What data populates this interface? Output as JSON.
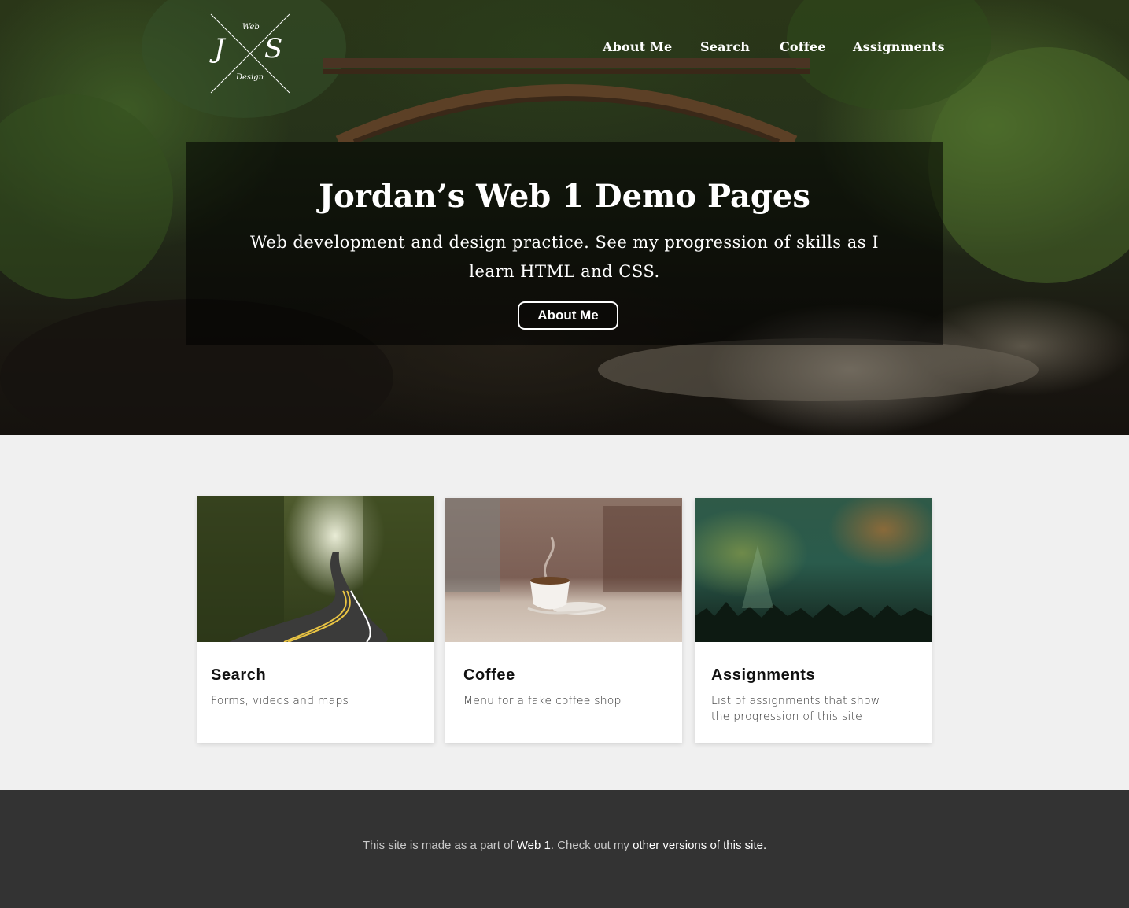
{
  "logo": {
    "initial_left": "J",
    "initial_right": "S",
    "top_word": "Web",
    "bottom_word": "Design"
  },
  "nav": {
    "items": [
      "About Me",
      "Search",
      "Coffee",
      "Assignments"
    ]
  },
  "hero": {
    "title": "Jordan’s Web 1 Demo Pages",
    "subtitle_line1": "Web development and design practice. See my progression of skills as I",
    "subtitle_line2": "learn HTML and CSS.",
    "button_label": "About Me"
  },
  "cards": [
    {
      "title": "Search",
      "description": "Forms, videos and maps"
    },
    {
      "title": "Coffee",
      "description": "Menu for a fake coffee shop"
    },
    {
      "title": "Assignments",
      "description_line1": "List of assignments that show",
      "description_line2": "the progression of this site"
    }
  ],
  "footer": {
    "text_before": "This site is made as a part of ",
    "link_web1": "Web 1",
    "text_middle": ". Check out my ",
    "link_versions": "other versions of this site."
  },
  "colors": {
    "footer_bg": "#333333",
    "page_bg": "#f0f0f0",
    "hero_overlay": "rgba(0,0,0,0.55)"
  }
}
